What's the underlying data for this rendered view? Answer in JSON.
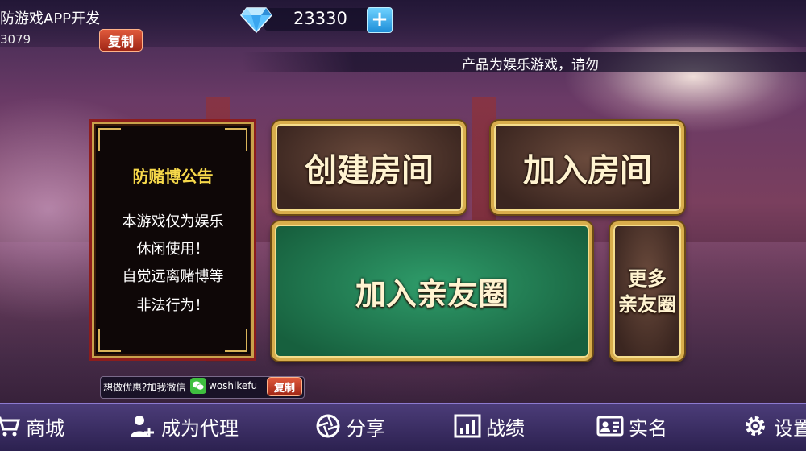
{
  "topbar": {
    "user_name": "防游戏APP开发",
    "user_id": "3079",
    "copy_label": "复制",
    "diamond_icon": "diamond-icon",
    "diamond_count": "23330",
    "plus_label": "+",
    "marquee": "产品为娱乐游戏，请勿"
  },
  "notice": {
    "title": "防赌博公告",
    "lines": [
      "本游戏仅为娱乐",
      "休闲使用！",
      "自觉远离赌博等",
      "非法行为！"
    ]
  },
  "buttons": {
    "create_room": "创建房间",
    "join_room": "加入房间",
    "join_circle": "加入亲友圈",
    "more_line1": "更多",
    "more_line2": "亲友圈"
  },
  "wechat": {
    "prompt": "想做优惠?加我微信",
    "icon": "wechat-icon",
    "id": "woshikefu",
    "copy_label": "复制"
  },
  "nav": {
    "items": [
      {
        "label": "商城",
        "icon": "cart-icon"
      },
      {
        "label": "成为代理",
        "icon": "agent-icon"
      },
      {
        "label": "分享",
        "icon": "share-icon"
      },
      {
        "label": "战绩",
        "icon": "chart-icon"
      },
      {
        "label": "实名",
        "icon": "id-card-icon"
      },
      {
        "label": "设置",
        "icon": "gear-icon"
      }
    ]
  },
  "colors": {
    "gold": "#d8ad4c",
    "notice_title": "#f6d84a",
    "nav_bg": "#4b3c78",
    "green_button": "#2f9c6a"
  }
}
